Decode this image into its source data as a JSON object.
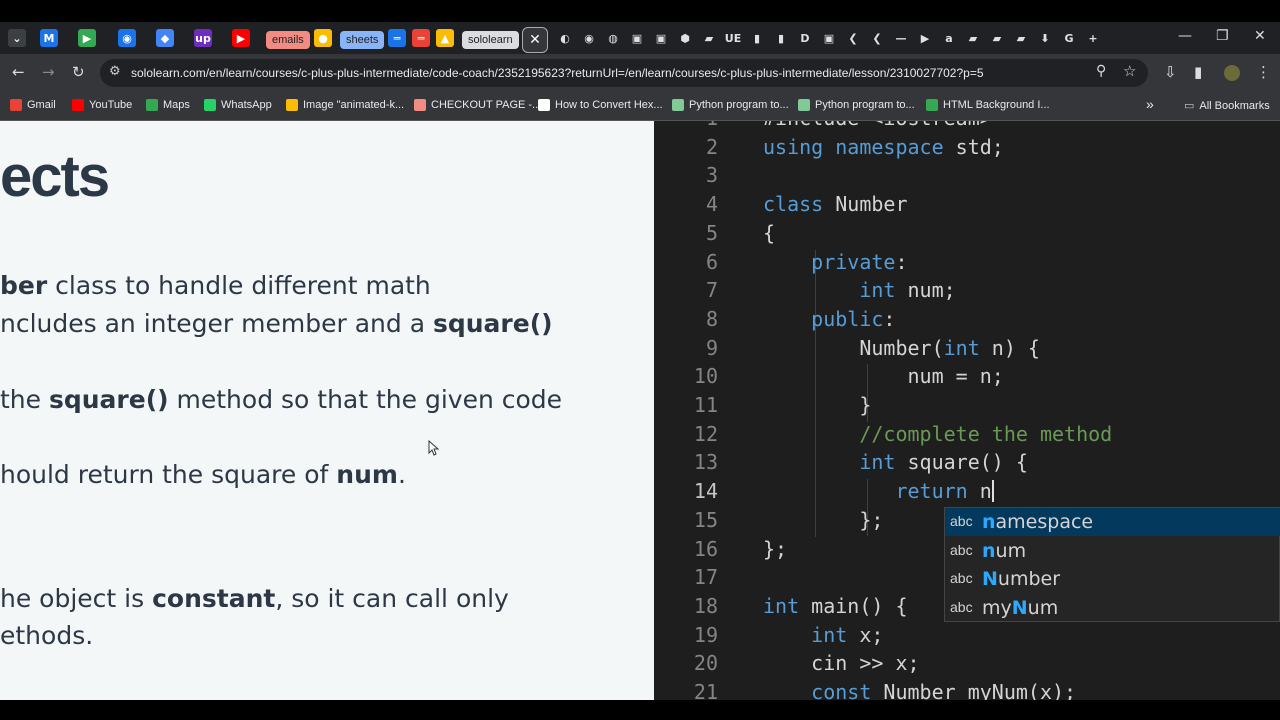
{
  "browser": {
    "tabs": [
      {
        "kind": "icon",
        "glyph": "⌄",
        "color": "#3c4043"
      },
      {
        "kind": "icon",
        "glyph": "M",
        "color": "#1a73e8"
      },
      {
        "kind": "icon",
        "glyph": "▶",
        "color": "#34a853"
      },
      {
        "kind": "icon",
        "glyph": "◉",
        "color": "#1a73e8"
      },
      {
        "kind": "icon",
        "glyph": "◆",
        "color": "#4285f4"
      },
      {
        "kind": "icon",
        "glyph": "up",
        "color": "#6f2dbd"
      },
      {
        "kind": "icon",
        "glyph": "▶",
        "color": "#ff0000"
      },
      {
        "kind": "pill",
        "label": "emails",
        "color": "#f28b82"
      },
      {
        "kind": "icon",
        "glyph": "●",
        "color": "#fbbc04"
      },
      {
        "kind": "pill",
        "label": "sheets",
        "color": "#8ab4f8"
      },
      {
        "kind": "icon",
        "glyph": "═",
        "color": "#1a73e8"
      },
      {
        "kind": "icon",
        "glyph": "═",
        "color": "#ea4335"
      },
      {
        "kind": "icon",
        "glyph": "▲",
        "color": "#fbbc04"
      },
      {
        "kind": "pill",
        "label": "sololearn",
        "color": "#dadce0"
      }
    ],
    "tabs_right": [
      "◐",
      "◉",
      "◍",
      "▣",
      "▣",
      "⬢",
      "▰",
      "UE",
      "▮",
      "▮",
      "D",
      "▣",
      "❮",
      "❮",
      "—",
      "▶",
      "a",
      "▰",
      "▰",
      "▰",
      "⬇",
      "G",
      "+"
    ],
    "active_tab_close": "✕",
    "url": "sololearn.com/en/learn/courses/c-plus-plus-intermediate/code-coach/2352195623?returnUrl=/en/learn/courses/c-plus-plus-intermediate/lesson/2310027702?p=5",
    "bookmarks": [
      {
        "label": "Gmail",
        "color": "#ea4335"
      },
      {
        "label": "YouTube",
        "color": "#ff0000"
      },
      {
        "label": "Maps",
        "color": "#34a853"
      },
      {
        "label": "WhatsApp",
        "color": "#25d366"
      },
      {
        "label": "Image \"animated-k...",
        "color": "#fbbc04"
      },
      {
        "label": "CHECKOUT PAGE -...",
        "color": "#f28b82"
      },
      {
        "label": "How to Convert Hex...",
        "color": "#ffffff"
      },
      {
        "label": "Python program to...",
        "color": "#81c995"
      },
      {
        "label": "Python program to...",
        "color": "#81c995"
      },
      {
        "label": "HTML Background I...",
        "color": "#34a853"
      }
    ],
    "more_bookmarks": "»",
    "all_bookmarks": "All Bookmarks"
  },
  "lesson": {
    "heading": "ects",
    "paragraphs": [
      [
        {
          "t": "ber",
          "b": true
        },
        {
          "t": " class to handle different math",
          "b": false
        }
      ],
      [
        {
          "t": "ncludes an integer member and a ",
          "b": false
        },
        {
          "t": "square()",
          "b": true
        }
      ],
      [
        {
          "t": "the ",
          "b": false
        },
        {
          "t": "square()",
          "b": true
        },
        {
          "t": " method so that the given code",
          "b": false
        }
      ],
      [
        {
          "t": "hould return the square of ",
          "b": false
        },
        {
          "t": "num",
          "b": true
        },
        {
          "t": ".",
          "b": false
        }
      ],
      [
        {
          "t": "he object is ",
          "b": false
        },
        {
          "t": "constant",
          "b": true
        },
        {
          "t": ", so it can call only",
          "b": false
        }
      ],
      [
        {
          "t": "ethods.",
          "b": false
        }
      ]
    ]
  },
  "editor": {
    "lines": [
      {
        "n": "1",
        "segs": [
          {
            "t": "#include <iostream>",
            "c": "default"
          }
        ]
      },
      {
        "n": "2",
        "segs": [
          {
            "t": "using namespace",
            "c": "kw"
          },
          {
            "t": " std;",
            "c": "default"
          }
        ]
      },
      {
        "n": "3",
        "segs": []
      },
      {
        "n": "4",
        "segs": [
          {
            "t": "class",
            "c": "kw"
          },
          {
            "t": " Number",
            "c": "default"
          }
        ]
      },
      {
        "n": "5",
        "segs": [
          {
            "t": "{",
            "c": "default"
          }
        ]
      },
      {
        "n": "6",
        "segs": [
          {
            "t": "    ",
            "c": "default"
          },
          {
            "t": "private",
            "c": "kw"
          },
          {
            "t": ":",
            "c": "default"
          }
        ]
      },
      {
        "n": "7",
        "segs": [
          {
            "t": "        ",
            "c": "default"
          },
          {
            "t": "int",
            "c": "kw"
          },
          {
            "t": " num;",
            "c": "default"
          }
        ]
      },
      {
        "n": "8",
        "segs": [
          {
            "t": "    ",
            "c": "default"
          },
          {
            "t": "public",
            "c": "kw"
          },
          {
            "t": ":",
            "c": "default"
          }
        ]
      },
      {
        "n": "9",
        "segs": [
          {
            "t": "        Number(",
            "c": "default"
          },
          {
            "t": "int",
            "c": "kw"
          },
          {
            "t": " n) {",
            "c": "default"
          }
        ]
      },
      {
        "n": "10",
        "segs": [
          {
            "t": "            num = n;",
            "c": "default"
          }
        ]
      },
      {
        "n": "11",
        "segs": [
          {
            "t": "        }",
            "c": "default"
          }
        ]
      },
      {
        "n": "12",
        "segs": [
          {
            "t": "        ",
            "c": "default"
          },
          {
            "t": "//complete the method",
            "c": "cm"
          }
        ]
      },
      {
        "n": "13",
        "segs": [
          {
            "t": "        ",
            "c": "default"
          },
          {
            "t": "int",
            "c": "kw"
          },
          {
            "t": " square() {",
            "c": "default"
          }
        ]
      },
      {
        "n": "14",
        "segs": [
          {
            "t": "           ",
            "c": "default"
          },
          {
            "t": "return",
            "c": "kw"
          },
          {
            "t": " n",
            "c": "default"
          }
        ],
        "cursor": true
      },
      {
        "n": "15",
        "segs": [
          {
            "t": "        };",
            "c": "default"
          }
        ]
      },
      {
        "n": "16",
        "segs": [
          {
            "t": "};",
            "c": "default"
          }
        ]
      },
      {
        "n": "17",
        "segs": []
      },
      {
        "n": "18",
        "segs": [
          {
            "t": "int",
            "c": "kw"
          },
          {
            "t": " main() {",
            "c": "default"
          }
        ]
      },
      {
        "n": "19",
        "segs": [
          {
            "t": "    ",
            "c": "default"
          },
          {
            "t": "int",
            "c": "kw"
          },
          {
            "t": " x;",
            "c": "default"
          }
        ]
      },
      {
        "n": "20",
        "segs": [
          {
            "t": "    cin >> x;",
            "c": "default"
          }
        ]
      },
      {
        "n": "21",
        "segs": [
          {
            "t": "    ",
            "c": "default"
          },
          {
            "t": "const",
            "c": "kw"
          },
          {
            "t": " Number myNum(x);",
            "c": "default"
          }
        ]
      }
    ],
    "current_line": "14",
    "suggestions": [
      {
        "kind": "abc",
        "pre": "",
        "match": "n",
        "post": "amespace",
        "selected": true
      },
      {
        "kind": "abc",
        "pre": "",
        "match": "n",
        "post": "um",
        "selected": false
      },
      {
        "kind": "abc",
        "pre": "",
        "match": "N",
        "post": "umber",
        "selected": false
      },
      {
        "kind": "abc",
        "pre": "my",
        "match": "N",
        "post": "um",
        "selected": false
      }
    ]
  }
}
